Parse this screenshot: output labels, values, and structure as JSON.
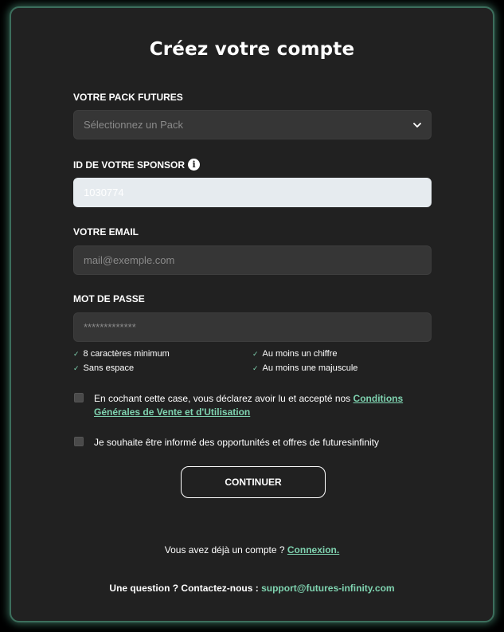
{
  "form": {
    "title": "Créez votre compte",
    "pack": {
      "label": "VOTRE PACK FUTURES",
      "placeholder": "Sélectionnez un Pack"
    },
    "sponsor": {
      "label": "ID DE VOTRE SPONSOR",
      "value": "1030774"
    },
    "email": {
      "label": "VOTRE EMAIL",
      "placeholder": "mail@exemple.com"
    },
    "password": {
      "label": "MOT DE PASSE",
      "placeholder": "*************",
      "requirements": [
        "8 caractères minimum",
        "Sans espace",
        "Au moins un chiffre",
        "Au moins une majuscule"
      ]
    },
    "terms": {
      "text": "En cochant cette case, vous déclarez avoir lu et accepté nos ",
      "link": "Conditions Générales de Vente et d'Utilisation",
      "checked": false
    },
    "newsletter": {
      "text": "Je souhaite être informé des opportunités et offres de futuresinfinity",
      "checked": false
    },
    "continue_label": "CONTINUER",
    "login_prompt": "Vous avez déjà un compte ?",
    "login_link": "Connexion.",
    "contact_prompt": "Une question ? Contactez-nous :",
    "contact_email": "support@futures-infinity.com"
  },
  "colors": {
    "panel_bg": "#212121",
    "panel_glow": "#3c6e5c",
    "accent": "#7fd3b0",
    "input_bg": "#363636",
    "sponsor_input_bg": "#e6ebef"
  },
  "icons": {
    "select_arrow": "chevron-down-icon",
    "sponsor_info": "info-icon",
    "requirement_check": "check-icon"
  }
}
